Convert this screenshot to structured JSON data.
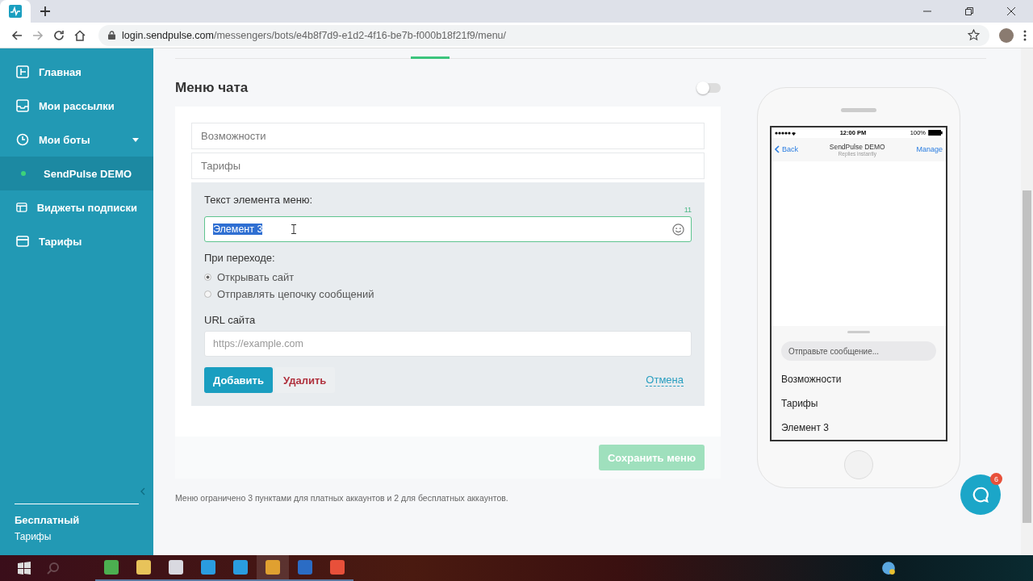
{
  "browser": {
    "tabs": [
      {
        "kind": "favicon",
        "selected": true
      }
    ],
    "address": {
      "domain": "login.sendpulse.com",
      "path": "/messengers/bots/e4b8f7d9-e1d2-4f16-be7b-f000b18f21f9/menu/"
    }
  },
  "sidebar": {
    "items": [
      {
        "label": "Главная",
        "selected": false
      },
      {
        "label": "Мои рассылки",
        "selected": false
      },
      {
        "label": "Мои боты",
        "selected": false,
        "expanded": true,
        "children": [
          {
            "label": "SendPulse DEMO",
            "selected": true
          }
        ]
      },
      {
        "label": "Виджеты подписки",
        "selected": false
      },
      {
        "label": "Тарифы",
        "selected": false
      }
    ],
    "plan": {
      "title": "Бесплатный",
      "link": "Тарифы"
    }
  },
  "page": {
    "title": "Меню чата",
    "enabled": false,
    "menu_items": [
      {
        "label": "Возможности"
      },
      {
        "label": "Тарифы"
      }
    ],
    "editor": {
      "label": "Текст элемента меню:",
      "counter": "11",
      "value": "Элемент 3",
      "value_selected": true,
      "action_label": "При переходе:",
      "options": [
        {
          "label": "Открывать сайт",
          "selected": true
        },
        {
          "label": "Отправлять цепочку сообщений",
          "selected": false
        }
      ],
      "url_label": "URL сайта",
      "url_placeholder": "https://example.com",
      "add": "Добавить",
      "delete": "Удалить",
      "cancel": "Отмена"
    },
    "save": {
      "label": "Сохранить меню",
      "disabled": true
    },
    "note": "Меню ограничено 3 пунктами для платных аккаунтов и 2 для бесплатных аккаунтов."
  },
  "phone": {
    "time": "12:00 PM",
    "battery": "100%",
    "back": "Back",
    "title": "SendPulse DEMO",
    "subtitle": "Replies instantly",
    "manage": "Manage",
    "input_placeholder": "Отправьте сообщение...",
    "menu": [
      {
        "label": "Возможности"
      },
      {
        "label": "Тарифы"
      },
      {
        "label": "Элемент 3"
      }
    ]
  },
  "chat_widget": {
    "badge": "6"
  },
  "taskbar": {
    "apps": [
      {
        "color": "#4caf50",
        "selected": false
      },
      {
        "color": "#e8c35a",
        "selected": false
      },
      {
        "color": "#d9d9e0",
        "selected": false
      },
      {
        "color": "#2a9ce0",
        "selected": false
      },
      {
        "color": "#2a9ce0",
        "selected": false
      },
      {
        "color": "#e0a030",
        "selected": true
      },
      {
        "color": "#2b6cc4",
        "selected": false
      },
      {
        "color": "#e8503a",
        "selected": false
      }
    ]
  }
}
